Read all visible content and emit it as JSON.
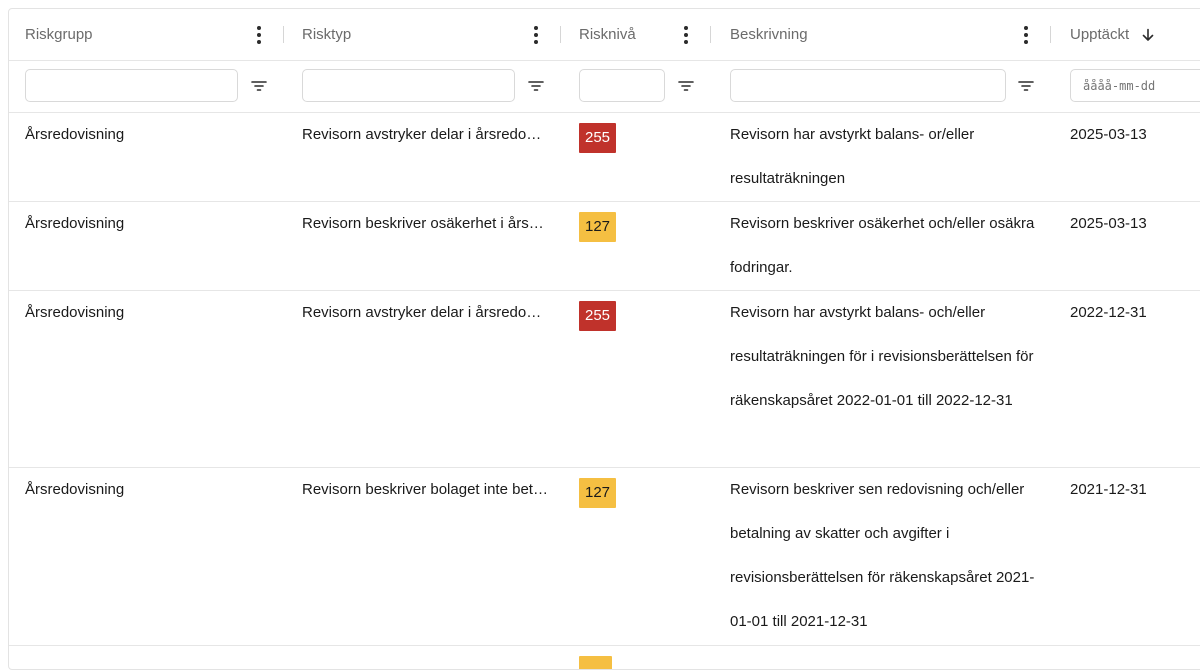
{
  "colors": {
    "high_risk": "#c0322b",
    "medium_risk": "#f5bf42",
    "high_risk_text": "#ffffff",
    "medium_risk_text": "#1a1a1a"
  },
  "columns": [
    {
      "label": "Riskgrupp"
    },
    {
      "label": "Risktyp"
    },
    {
      "label": "Risknivå"
    },
    {
      "label": "Beskrivning"
    },
    {
      "label": "Upptäckt",
      "sort": "descending"
    }
  ],
  "filters": {
    "riskgrupp": {
      "value": "",
      "placeholder": ""
    },
    "risktyp": {
      "value": "",
      "placeholder": ""
    },
    "risknivå": {
      "value": "",
      "placeholder": ""
    },
    "beskrivning": {
      "value": "",
      "placeholder": ""
    },
    "upptackt": {
      "value": "",
      "placeholder": "åååå-mm-dd"
    }
  },
  "rows": [
    {
      "riskgrupp": "Årsredovisning",
      "risktyp": "Revisorn avstryker delar i årsredovisningen",
      "risknivå": "255",
      "level": "high",
      "beskrivning": "Revisorn har avstyrkt balans- or/eller resultaträkningen",
      "upptackt": "2025-03-13"
    },
    {
      "riskgrupp": "Årsredovisning",
      "risktyp": "Revisorn beskriver osäkerhet i årsredovisningen",
      "risknivå": "127",
      "level": "medium",
      "beskrivning": "Revisorn beskriver osäkerhet och/eller osäkra fodringar.",
      "upptackt": "2025-03-13"
    },
    {
      "riskgrupp": "Årsredovisning",
      "risktyp": "Revisorn avstryker delar i årsredovisningen",
      "risknivå": "255",
      "level": "high",
      "beskrivning": "Revisorn har avstyrkt balans- och/eller resultaträkningen för i revisionsberättelsen för räkenskapsåret 2022-01-01 till 2022-12-31",
      "upptackt": "2022-12-31"
    },
    {
      "riskgrupp": "Årsredovisning",
      "risktyp": "Revisorn beskriver bolaget inte betalat skatter",
      "risknivå": "127",
      "level": "medium",
      "beskrivning": "Revisorn beskriver sen redovisning och/eller betalning av skatter och avgifter i revisionsberättelsen för räkenskapsåret 2021-01-01 till 2021-12-31",
      "upptackt": "2021-12-31"
    },
    {
      "riskgrupp": "",
      "risktyp": "",
      "risknivå": "",
      "level": "medium",
      "beskrivning": "",
      "upptackt": ""
    }
  ]
}
